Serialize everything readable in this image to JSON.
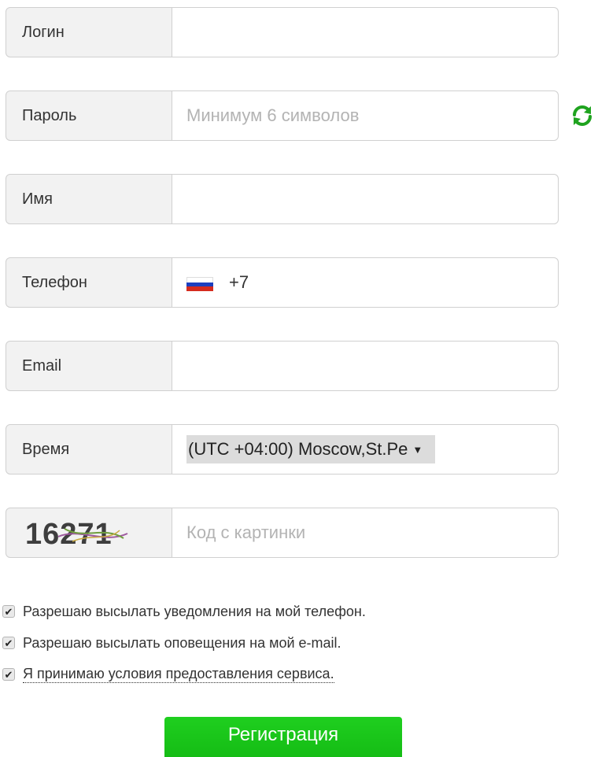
{
  "login": {
    "label": "Логин",
    "value": ""
  },
  "password": {
    "label": "Пароль",
    "placeholder": "Минимум 6 символов"
  },
  "name": {
    "label": "Имя",
    "value": ""
  },
  "phone": {
    "label": "Телефон",
    "prefix": "+7",
    "flag_colors": [
      "#ffffff",
      "#1c3fbf",
      "#d52b1e"
    ]
  },
  "email": {
    "label": "Email",
    "value": ""
  },
  "timezone": {
    "label": "Время",
    "selected": "(UTC +04:00) Moscow,St.Pe",
    "arrow": "▼"
  },
  "captcha": {
    "code": "16271",
    "placeholder": "Код с картинки"
  },
  "checkboxes": [
    {
      "label": "Разрешаю высылать уведомления на мой телефон.",
      "checked": true
    },
    {
      "label": "Разрешаю высылать оповещения на мой e-mail.",
      "checked": true
    },
    {
      "label": "Я принимаю условия предоставления сервиса.",
      "checked": true
    }
  ],
  "check_mark": "✔",
  "submit": {
    "label": "Регистрация"
  },
  "colors": {
    "accent_green": "#18c418",
    "refresh_green": "#1fa31f"
  }
}
